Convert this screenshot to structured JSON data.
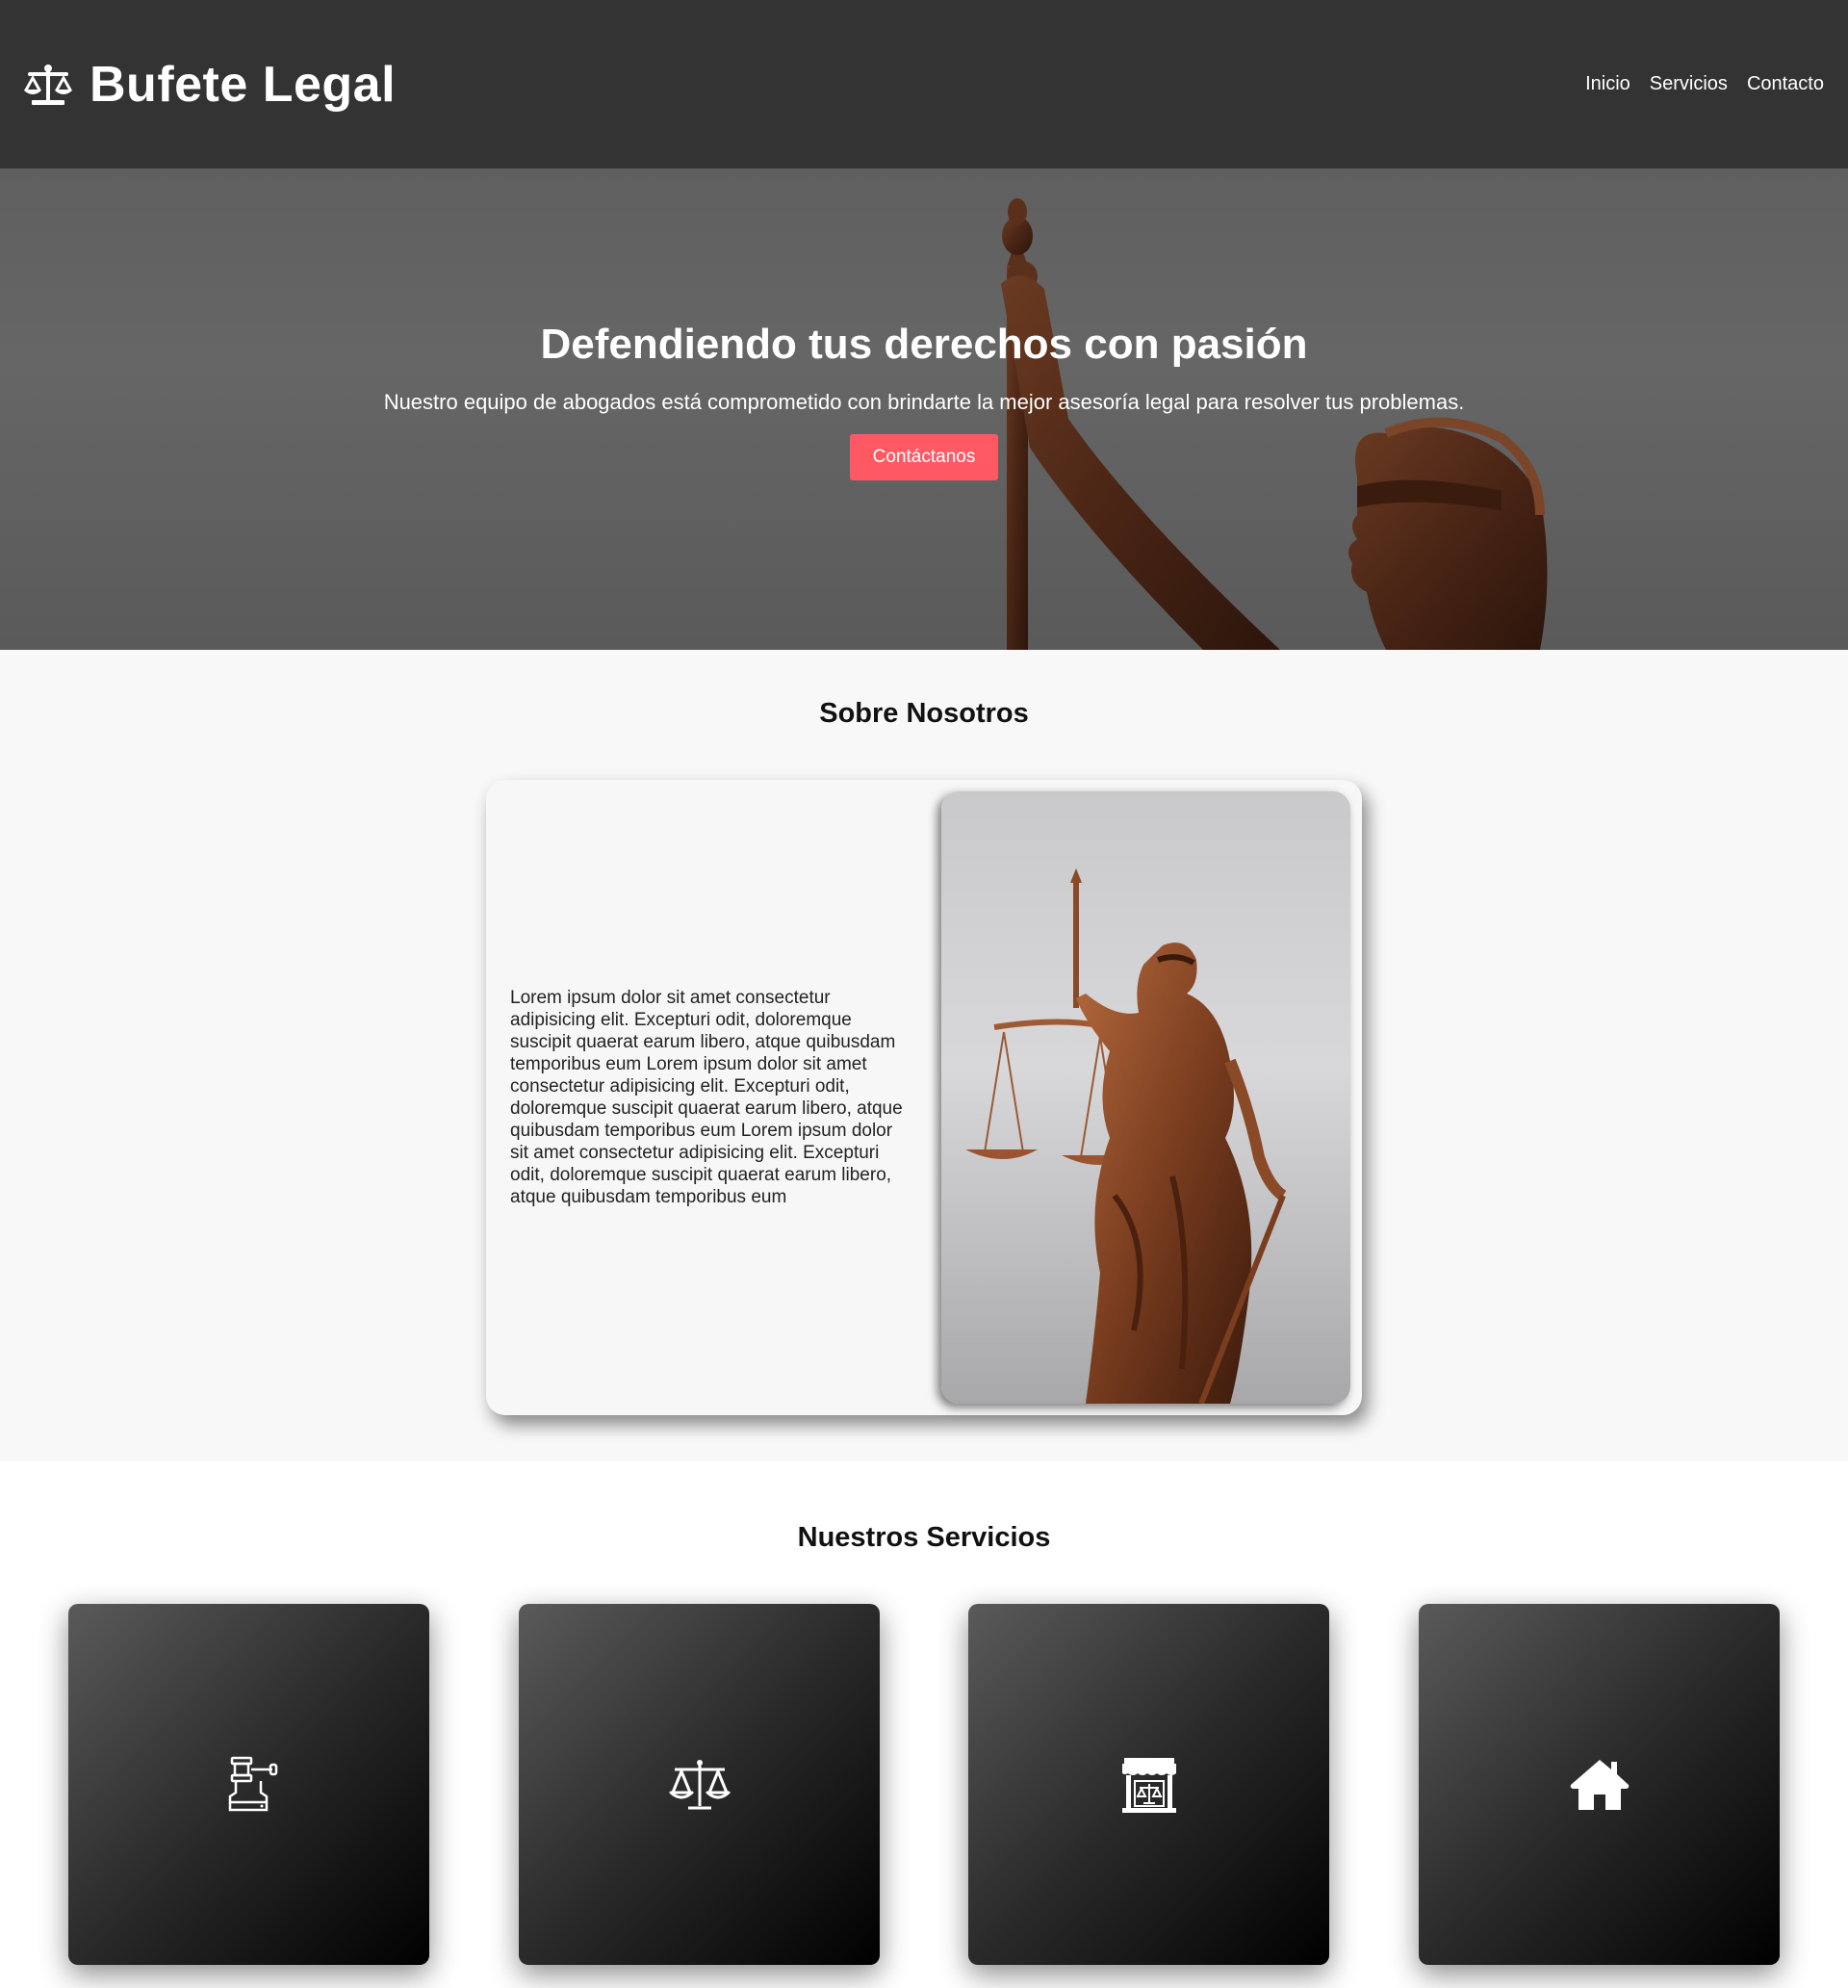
{
  "header": {
    "brand_icon": "scale-icon",
    "brand_title": "Bufete Legal",
    "nav": [
      {
        "label": "Inicio"
      },
      {
        "label": "Servicios"
      },
      {
        "label": "Contacto"
      }
    ]
  },
  "hero": {
    "title": "Defendiendo tus derechos con pasión",
    "subtitle": "Nuestro equipo de abogados está comprometido con brindarte la mejor asesoría legal para resolver tus problemas.",
    "button_label": "Contáctanos",
    "button_color": "#ff5a64"
  },
  "about": {
    "title": "Sobre Nosotros",
    "text": "Lorem ipsum dolor sit amet consectetur adipisicing elit. Excepturi odit, doloremque suscipit quaerat earum libero, atque quibusdam temporibus eum Lorem ipsum dolor sit amet consectetur adipisicing elit. Excepturi odit, doloremque suscipit quaerat earum libero, atque quibusdam temporibus eum Lorem ipsum dolor sit amet consectetur adipisicing elit. Excepturi odit, doloremque suscipit quaerat earum libero, atque quibusdam temporibus eum"
  },
  "services": {
    "title": "Nuestros Servicios",
    "cards": [
      {
        "icon": "gavel-icon"
      },
      {
        "icon": "scale-icon"
      },
      {
        "icon": "courthouse-icon"
      },
      {
        "icon": "home-icon"
      }
    ]
  }
}
